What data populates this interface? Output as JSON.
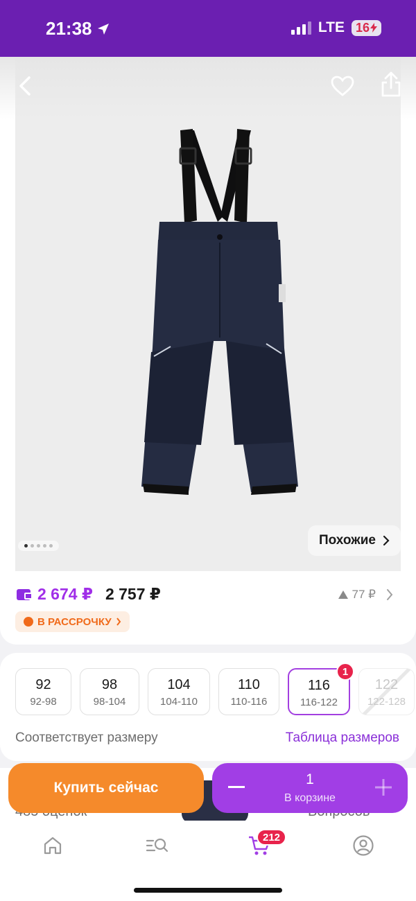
{
  "status_bar": {
    "time": "21:38",
    "network": "LTE",
    "battery": "16"
  },
  "product": {
    "image_alt": "Navy kids winter ski pants with black suspenders",
    "carousel_count": 5,
    "carousel_active": 1
  },
  "similar_label": "Похожие",
  "price": {
    "current": "2 674 ₽",
    "regular": "2 757 ₽",
    "delta": "77 ₽",
    "installment": "В РАССРОЧКУ"
  },
  "sizes": [
    {
      "size": "92",
      "range": "92-98",
      "state": "normal"
    },
    {
      "size": "98",
      "range": "98-104",
      "state": "normal"
    },
    {
      "size": "104",
      "range": "104-110",
      "state": "normal"
    },
    {
      "size": "110",
      "range": "110-116",
      "state": "normal"
    },
    {
      "size": "116",
      "range": "116-122",
      "state": "selected",
      "badge": "1"
    },
    {
      "size": "122",
      "range": "122-128",
      "state": "unavailable"
    }
  ],
  "size_fit": "Соответствует размеру",
  "size_table": "Таблица размеров",
  "peek": {
    "ratings": "485 оценок",
    "questions": "Вопросов"
  },
  "buy_now": "Купить сейчас",
  "cart": {
    "quantity": "1",
    "label": "В корзине"
  },
  "tabbar": {
    "cart_count": "212"
  },
  "colors": {
    "brand": "#6b1fb1",
    "accent": "#a13ee5",
    "orange": "#f58a2b",
    "badge": "#e8234b"
  }
}
